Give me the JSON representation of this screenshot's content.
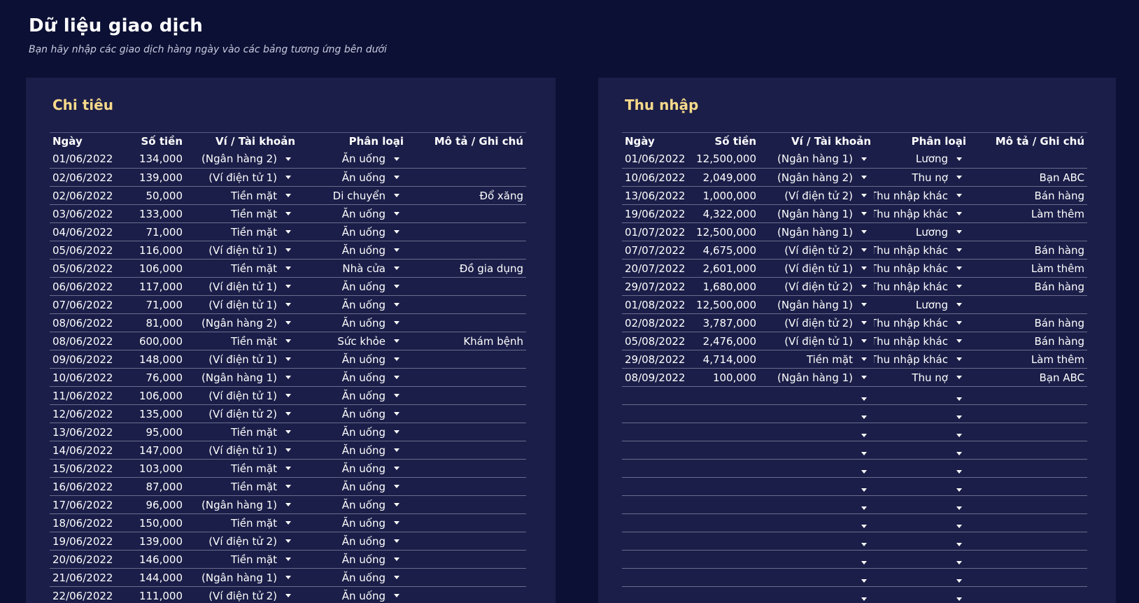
{
  "page": {
    "title": "Dữ liệu giao dịch",
    "subtitle": "Bạn hãy nhập các giao dịch hàng ngày vào các bảng tương ứng bên dưới"
  },
  "colors": {
    "background": "#0c1034",
    "panel": "#1b1e48",
    "panel_title": "#f6d98a",
    "text": "#ffffff"
  },
  "expenses": {
    "title": "Chi tiêu",
    "columns": [
      "Ngày",
      "Số tiền",
      "Ví / Tài khoản",
      "Phân loại",
      "Mô tả / Ghi chú"
    ],
    "rows": [
      {
        "date": "01/06/2022",
        "amount": "134,000",
        "wallet": "(Ngân hàng 2)",
        "category": "Ăn uống",
        "note": ""
      },
      {
        "date": "02/06/2022",
        "amount": "139,000",
        "wallet": "(Ví điện tử 1)",
        "category": "Ăn uống",
        "note": ""
      },
      {
        "date": "02/06/2022",
        "amount": "50,000",
        "wallet": "Tiền mặt",
        "category": "Di chuyển",
        "note": "Đổ xăng"
      },
      {
        "date": "03/06/2022",
        "amount": "133,000",
        "wallet": "Tiền mặt",
        "category": "Ăn uống",
        "note": ""
      },
      {
        "date": "04/06/2022",
        "amount": "71,000",
        "wallet": "Tiền mặt",
        "category": "Ăn uống",
        "note": ""
      },
      {
        "date": "05/06/2022",
        "amount": "116,000",
        "wallet": "(Ví điện tử 1)",
        "category": "Ăn uống",
        "note": ""
      },
      {
        "date": "05/06/2022",
        "amount": "106,000",
        "wallet": "Tiền mặt",
        "category": "Nhà cửa",
        "note": "Đồ gia dụng"
      },
      {
        "date": "06/06/2022",
        "amount": "117,000",
        "wallet": "(Ví điện tử 1)",
        "category": "Ăn uống",
        "note": ""
      },
      {
        "date": "07/06/2022",
        "amount": "71,000",
        "wallet": "(Ví điện tử 1)",
        "category": "Ăn uống",
        "note": ""
      },
      {
        "date": "08/06/2022",
        "amount": "81,000",
        "wallet": "(Ngân hàng 2)",
        "category": "Ăn uống",
        "note": ""
      },
      {
        "date": "08/06/2022",
        "amount": "600,000",
        "wallet": "Tiền mặt",
        "category": "Sức khỏe",
        "note": "Khám bệnh"
      },
      {
        "date": "09/06/2022",
        "amount": "148,000",
        "wallet": "(Ví điện tử 1)",
        "category": "Ăn uống",
        "note": ""
      },
      {
        "date": "10/06/2022",
        "amount": "76,000",
        "wallet": "(Ngân hàng 1)",
        "category": "Ăn uống",
        "note": ""
      },
      {
        "date": "11/06/2022",
        "amount": "106,000",
        "wallet": "(Ví điện tử 1)",
        "category": "Ăn uống",
        "note": ""
      },
      {
        "date": "12/06/2022",
        "amount": "135,000",
        "wallet": "(Ví điện tử 2)",
        "category": "Ăn uống",
        "note": ""
      },
      {
        "date": "13/06/2022",
        "amount": "95,000",
        "wallet": "Tiền mặt",
        "category": "Ăn uống",
        "note": ""
      },
      {
        "date": "14/06/2022",
        "amount": "147,000",
        "wallet": "(Ví điện tử 1)",
        "category": "Ăn uống",
        "note": ""
      },
      {
        "date": "15/06/2022",
        "amount": "103,000",
        "wallet": "Tiền mặt",
        "category": "Ăn uống",
        "note": ""
      },
      {
        "date": "16/06/2022",
        "amount": "87,000",
        "wallet": "Tiền mặt",
        "category": "Ăn uống",
        "note": ""
      },
      {
        "date": "17/06/2022",
        "amount": "96,000",
        "wallet": "(Ngân hàng 1)",
        "category": "Ăn uống",
        "note": ""
      },
      {
        "date": "18/06/2022",
        "amount": "150,000",
        "wallet": "Tiền mặt",
        "category": "Ăn uống",
        "note": ""
      },
      {
        "date": "19/06/2022",
        "amount": "139,000",
        "wallet": "(Ví điện tử 2)",
        "category": "Ăn uống",
        "note": ""
      },
      {
        "date": "20/06/2022",
        "amount": "146,000",
        "wallet": "Tiền mặt",
        "category": "Ăn uống",
        "note": ""
      },
      {
        "date": "21/06/2022",
        "amount": "144,000",
        "wallet": "(Ngân hàng 1)",
        "category": "Ăn uống",
        "note": ""
      },
      {
        "date": "22/06/2022",
        "amount": "111,000",
        "wallet": "(Ví điện tử 2)",
        "category": "Ăn uống",
        "note": ""
      }
    ]
  },
  "income": {
    "title": "Thu nhập",
    "columns": [
      "Ngày",
      "Số tiền",
      "Ví / Tài khoản",
      "Phân loại",
      "Mô tả / Ghi chú"
    ],
    "rows": [
      {
        "date": "01/06/2022",
        "amount": "12,500,000",
        "wallet": "(Ngân hàng 1)",
        "category": "Lương",
        "note": ""
      },
      {
        "date": "10/06/2022",
        "amount": "2,049,000",
        "wallet": "(Ngân hàng 2)",
        "category": "Thu nợ",
        "note": "Bạn ABC"
      },
      {
        "date": "13/06/2022",
        "amount": "1,000,000",
        "wallet": "(Ví điện tử 2)",
        "category": "Thu nhập khác",
        "note": "Bán hàng"
      },
      {
        "date": "19/06/2022",
        "amount": "4,322,000",
        "wallet": "(Ngân hàng 1)",
        "category": "Thu nhập khác",
        "note": "Làm thêm"
      },
      {
        "date": "01/07/2022",
        "amount": "12,500,000",
        "wallet": "(Ngân hàng 1)",
        "category": "Lương",
        "note": ""
      },
      {
        "date": "07/07/2022",
        "amount": "4,675,000",
        "wallet": "(Ví điện tử 2)",
        "category": "Thu nhập khác",
        "note": "Bán hàng"
      },
      {
        "date": "20/07/2022",
        "amount": "2,601,000",
        "wallet": "(Ví điện tử 1)",
        "category": "Thu nhập khác",
        "note": "Làm thêm"
      },
      {
        "date": "29/07/2022",
        "amount": "1,680,000",
        "wallet": "(Ví điện tử 2)",
        "category": "Thu nhập khác",
        "note": "Bán hàng"
      },
      {
        "date": "01/08/2022",
        "amount": "12,500,000",
        "wallet": "(Ngân hàng 1)",
        "category": "Lương",
        "note": ""
      },
      {
        "date": "02/08/2022",
        "amount": "3,787,000",
        "wallet": "(Ví điện tử 2)",
        "category": "Thu nhập khác",
        "note": "Bán hàng"
      },
      {
        "date": "05/08/2022",
        "amount": "2,476,000",
        "wallet": "(Ví điện tử 1)",
        "category": "Thu nhập khác",
        "note": "Bán hàng"
      },
      {
        "date": "29/08/2022",
        "amount": "4,714,000",
        "wallet": "Tiền mặt",
        "category": "Thu nhập khác",
        "note": "Làm thêm"
      },
      {
        "date": "08/09/2022",
        "amount": "100,000",
        "wallet": "(Ngân hàng 1)",
        "category": "Thu nợ",
        "note": "Bạn ABC"
      },
      {
        "date": "",
        "amount": "",
        "wallet": "",
        "category": "",
        "note": ""
      },
      {
        "date": "",
        "amount": "",
        "wallet": "",
        "category": "",
        "note": ""
      },
      {
        "date": "",
        "amount": "",
        "wallet": "",
        "category": "",
        "note": ""
      },
      {
        "date": "",
        "amount": "",
        "wallet": "",
        "category": "",
        "note": ""
      },
      {
        "date": "",
        "amount": "",
        "wallet": "",
        "category": "",
        "note": ""
      },
      {
        "date": "",
        "amount": "",
        "wallet": "",
        "category": "",
        "note": ""
      },
      {
        "date": "",
        "amount": "",
        "wallet": "",
        "category": "",
        "note": ""
      },
      {
        "date": "",
        "amount": "",
        "wallet": "",
        "category": "",
        "note": ""
      },
      {
        "date": "",
        "amount": "",
        "wallet": "",
        "category": "",
        "note": ""
      },
      {
        "date": "",
        "amount": "",
        "wallet": "",
        "category": "",
        "note": ""
      },
      {
        "date": "",
        "amount": "",
        "wallet": "",
        "category": "",
        "note": ""
      },
      {
        "date": "",
        "amount": "",
        "wallet": "",
        "category": "",
        "note": ""
      }
    ]
  },
  "icons": {
    "dropdown": "chevron-down-icon"
  }
}
